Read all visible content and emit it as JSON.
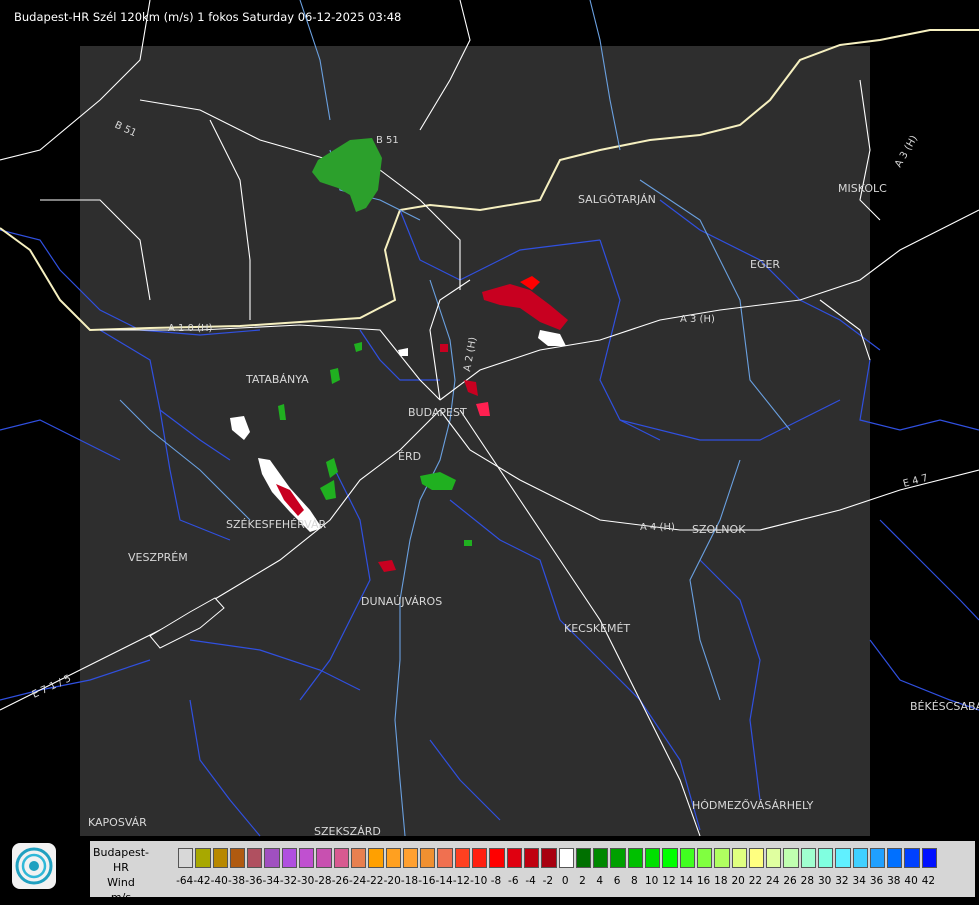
{
  "title": "Budapest-HR Szél 120km (m/s) 1 fokos Saturday 06-12-2025 03:48",
  "map": {
    "cities": [
      {
        "name": "SALGÓTARJÁN"
      },
      {
        "name": "MISKOLC"
      },
      {
        "name": "EGER"
      },
      {
        "name": "TATABÁNYA"
      },
      {
        "name": "BUDAPEST"
      },
      {
        "name": "ÉRD"
      },
      {
        "name": "SZÉKESFEHÉRVÁR"
      },
      {
        "name": "VESZPRÉM"
      },
      {
        "name": "DUNAÚJVÁROS"
      },
      {
        "name": "KECSKEMÉT"
      },
      {
        "name": "SZOLNOK"
      },
      {
        "name": "BÉKÉSCSABA"
      },
      {
        "name": "HÓDMEZŐVÁSÁRHELY"
      },
      {
        "name": "KAPOSVÁR"
      },
      {
        "name": "SZEKSZÁRD"
      }
    ],
    "roads": [
      "B 51",
      "B 51",
      "A 3 (H)",
      "A 3 (H)",
      "A 1 0 (H)",
      "A 2 (H)",
      "A 4 (H)",
      "E 4 7",
      "E 7 1 / 5"
    ]
  },
  "legend": {
    "line1": "Budapest-HR",
    "line2": "Wind",
    "line3": "m/s",
    "colors": [
      "#d8d8d8",
      "#a8a800",
      "#b88800",
      "#b05a10",
      "#b05060",
      "#a050c0",
      "#b050e0",
      "#c050d0",
      "#c850b0",
      "#d85a90",
      "#e88050",
      "#ffa000",
      "#ffa020",
      "#ffa030",
      "#f09030",
      "#f07050",
      "#ff4020",
      "#ff2010",
      "#ff0000",
      "#e00010",
      "#c00010",
      "#a80010",
      "#ffffff",
      "#007000",
      "#008800",
      "#00a000",
      "#00c000",
      "#00e000",
      "#00ff00",
      "#40ff20",
      "#80ff40",
      "#b0ff60",
      "#e0ff80",
      "#ffff80",
      "#e0ffa0",
      "#c0ffb0",
      "#a0ffd0",
      "#80ffe0",
      "#60f0ff",
      "#40d0ff",
      "#20a0ff",
      "#0070ff",
      "#0040ff",
      "#0010ff"
    ],
    "ticks": [
      "-64",
      "-42",
      "-40",
      "-38",
      "-36",
      "-34",
      "-32",
      "-30",
      "-28",
      "-26",
      "-24",
      "-22",
      "-20",
      "-18",
      "-16",
      "-14",
      "-12",
      "-10",
      "-8",
      "-6",
      "-4",
      "-2",
      "0",
      "2",
      "4",
      "6",
      "8",
      "10",
      "12",
      "14",
      "16",
      "18",
      "20",
      "22",
      "24",
      "26",
      "28",
      "30",
      "32",
      "34",
      "36",
      "38",
      "40",
      "42"
    ]
  }
}
